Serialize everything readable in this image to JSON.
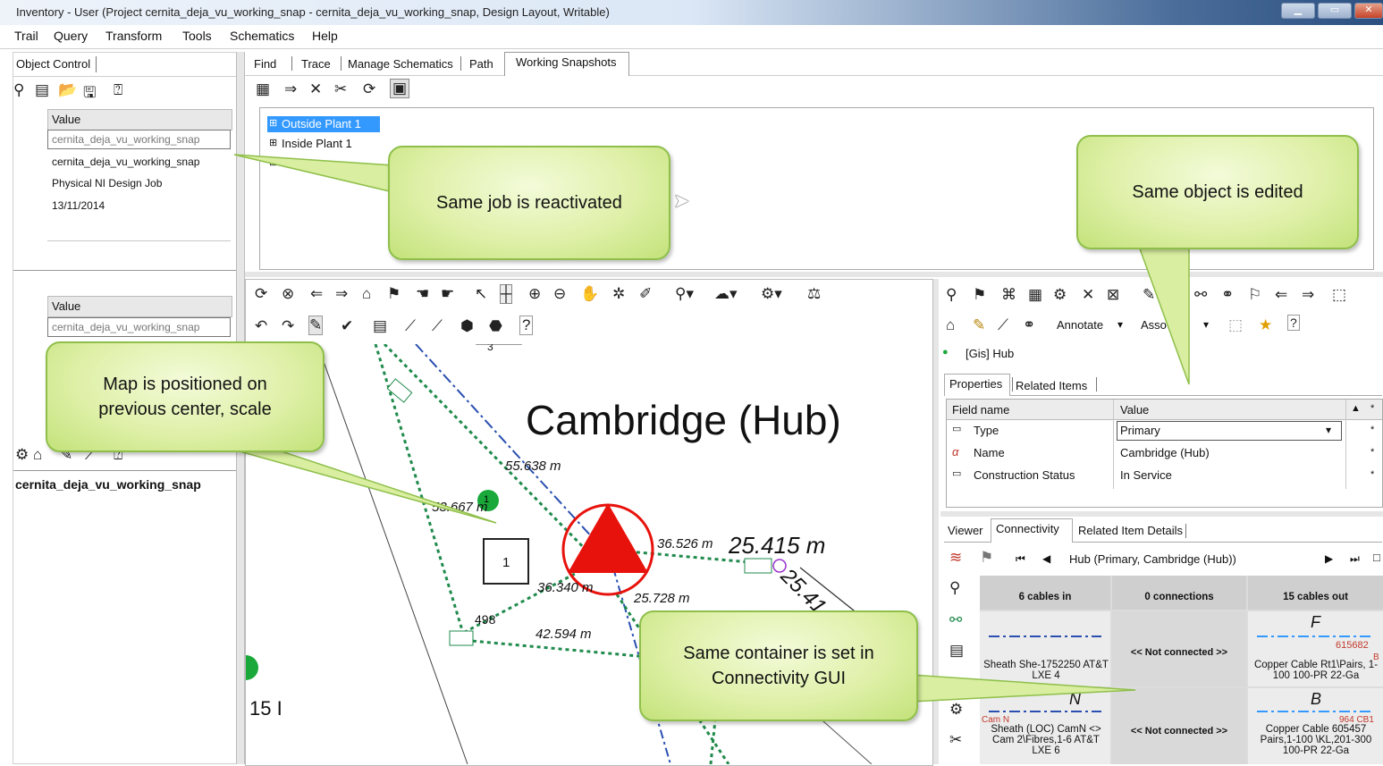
{
  "window": {
    "title": "Inventory - User (Project cernita_deja_vu_working_snap - cernita_deja_vu_working_snap, Design Layout, Writable)"
  },
  "menu": [
    "Trail",
    "Query",
    "Transform",
    "Tools",
    "Schematics",
    "Help"
  ],
  "left_panel": {
    "title": "Object Control",
    "value_header": "Value",
    "values": [
      "cernita_deja_vu_working_snap",
      "cernita_deja_vu_working_snap",
      "Physical NI Design Job",
      "13/11/2014"
    ],
    "value_header2": "Value",
    "value2": "cernita_deja_vu_working_snap",
    "job_name": "cernita_deja_vu_working_snap"
  },
  "tabs": [
    "Find",
    "Trace",
    "Manage Schematics",
    "Path",
    "Working Snapshots"
  ],
  "tree": [
    "Outside Plant 1",
    "Inside Plant 1",
    "Outs"
  ],
  "map": {
    "title": "Cambridge (Hub)",
    "labels": {
      "l1": "55.638 m",
      "l2": "53.667 m",
      "l3": "36.526 m",
      "l4": "25.415 m",
      "l5": "25.41",
      "l6": "36.340 m",
      "l7": "25.728 m",
      "l8": "42.594 m",
      "l9": "498",
      "l10": "15 I",
      "box1": "1",
      "box3": "3",
      "node1": "1"
    }
  },
  "editor": {
    "annotate_label": "Annotate",
    "assoc_label": "Asso",
    "object_title": "[Gis] Hub",
    "tabs": [
      "Properties",
      "Related Items"
    ],
    "columns": [
      "Field name",
      "Value"
    ],
    "rows": [
      {
        "field": "Type",
        "value": "Primary"
      },
      {
        "field": "Name",
        "value": "Cambridge (Hub)"
      },
      {
        "field": "Construction Status",
        "value": "In Service"
      }
    ]
  },
  "connectivity": {
    "tabs": [
      "Viewer",
      "Connectivity",
      "Related Item Details"
    ],
    "nav_title": "Hub (Primary, Cambridge (Hub))",
    "headers": [
      "6 cables in",
      "0 connections",
      "15 cables out"
    ],
    "rows": [
      {
        "in": "Sheath She-1752250 AT&T LXE 4",
        "in_letter": "",
        "conn": "<< Not connected >>",
        "out_letter": "F",
        "out": "Copper Cable Rt1\\Pairs, 1-100 100-PR 22-Ga",
        "out_code": "615682",
        "out_code2": "B"
      },
      {
        "in": "Sheath (LOC) CamN <> Cam 2\\Fibres,1-6 AT&T LXE 6",
        "in_letter": "N",
        "in_code": "Cam N",
        "conn": "<< Not connected >>",
        "out_letter": "B",
        "out": "Copper Cable 605457 Pairs,1-100 \\KL,201-300 100-PR 22-Ga",
        "out_code": "964 CB1"
      }
    ]
  },
  "callouts": {
    "c1": "Same job is reactivated",
    "c2": "Same object is edited",
    "c3": "Map is positioned on previous center, scale",
    "c4": "Same container is set in Connectivity GUI"
  },
  "colors": {
    "accent_red": "#e8120c",
    "callout_green": "#d9eea0",
    "selection_blue": "#3399ff",
    "network_green": "#1f8a4c",
    "network_blue": "#2a4fb0"
  }
}
